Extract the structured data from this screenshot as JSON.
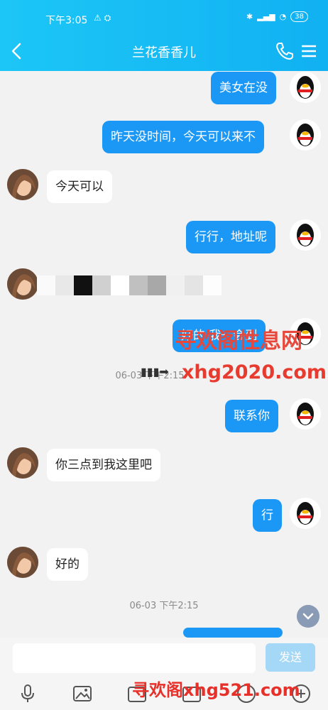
{
  "status": {
    "time": "下午3:05",
    "notif": "⚠ ⛭",
    "battery": "38"
  },
  "header": {
    "title": "兰花香香儿"
  },
  "messages": [
    {
      "side": "me",
      "text": "美女在没"
    },
    {
      "side": "me",
      "text": "昨天没时间，今天可以来不"
    },
    {
      "side": "them",
      "text": "今天可以"
    },
    {
      "side": "me",
      "text": "行行，地址呢"
    },
    {
      "side": "them",
      "text": ""
    },
    {
      "side": "me",
      "text": "好的 我一会到"
    },
    {
      "side": "me",
      "text": "联系你"
    },
    {
      "side": "them",
      "text": "你三点到我这里吧"
    },
    {
      "side": "me",
      "text": "行"
    },
    {
      "side": "them",
      "text": "好的"
    }
  ],
  "timestamps": {
    "t1": "06-03 下午2:15",
    "t2": "06-03 下午2:15"
  },
  "watermarks": {
    "w1": "寻欢阁性息网",
    "w2": "xhg2020.com",
    "w3": "寻欢阁xhg521.com"
  },
  "input": {
    "placeholder": "",
    "send_label": "发送"
  },
  "colors": {
    "header": "#14b8f4",
    "my_bubble": "#1b98f5",
    "send_disabled": "#a5d7f7"
  }
}
